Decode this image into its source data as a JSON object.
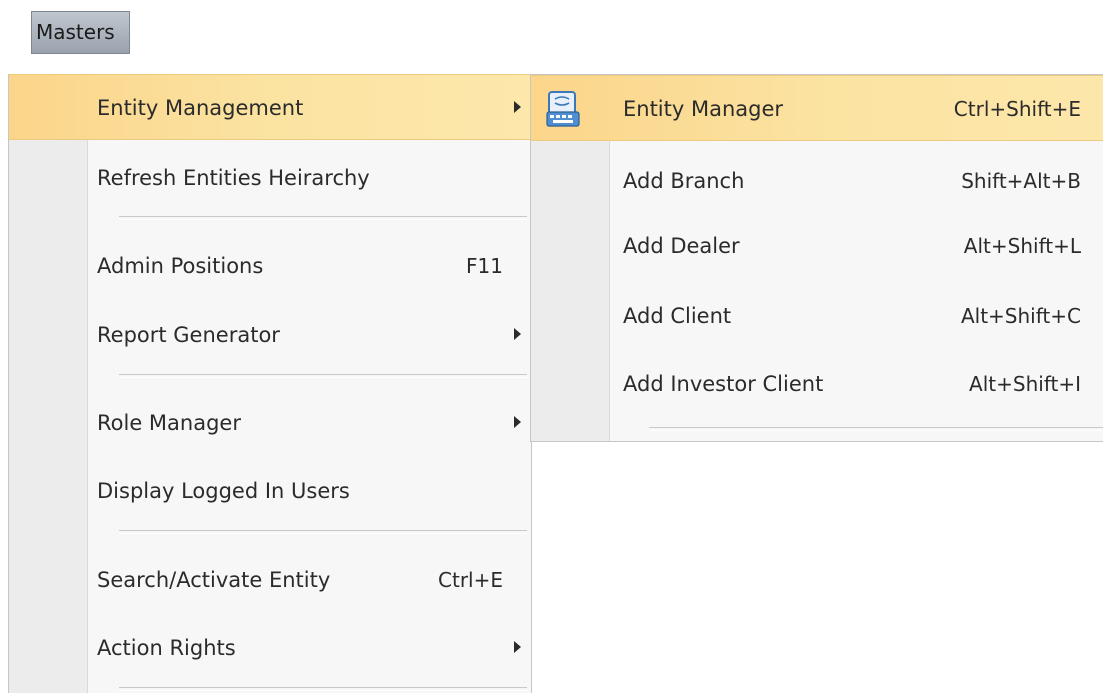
{
  "menubar": {
    "masters_label": "Masters"
  },
  "main_menu": {
    "items": [
      {
        "label": "Entity Management",
        "shortcut": "",
        "submenu": true,
        "highlighted": true
      },
      {
        "label": "Refresh Entities Heirarchy",
        "shortcut": ""
      },
      {
        "label": "Admin Positions",
        "shortcut": "F11"
      },
      {
        "label": "Report Generator",
        "shortcut": "",
        "submenu": true
      },
      {
        "label": "Role Manager",
        "shortcut": "",
        "submenu": true
      },
      {
        "label": "Display Logged In Users",
        "shortcut": ""
      },
      {
        "label": "Search/Activate Entity",
        "shortcut": "Ctrl+E"
      },
      {
        "label": "Action Rights",
        "shortcut": "",
        "submenu": true
      }
    ]
  },
  "sub_menu": {
    "items": [
      {
        "label": "Entity Manager",
        "shortcut": "Ctrl+Shift+E",
        "icon": "keyboard-icon",
        "highlighted": true
      },
      {
        "label": "Add Branch",
        "shortcut": "Shift+Alt+B"
      },
      {
        "label": "Add Dealer",
        "shortcut": "Alt+Shift+L"
      },
      {
        "label": "Add Client",
        "shortcut": "Alt+Shift+C"
      },
      {
        "label": "Add Investor Client",
        "shortcut": "Alt+Shift+I"
      }
    ]
  },
  "colors": {
    "highlight": "#fbd58a",
    "menubar_button": "#9aa3ad",
    "menu_background": "#f7f7f7"
  }
}
